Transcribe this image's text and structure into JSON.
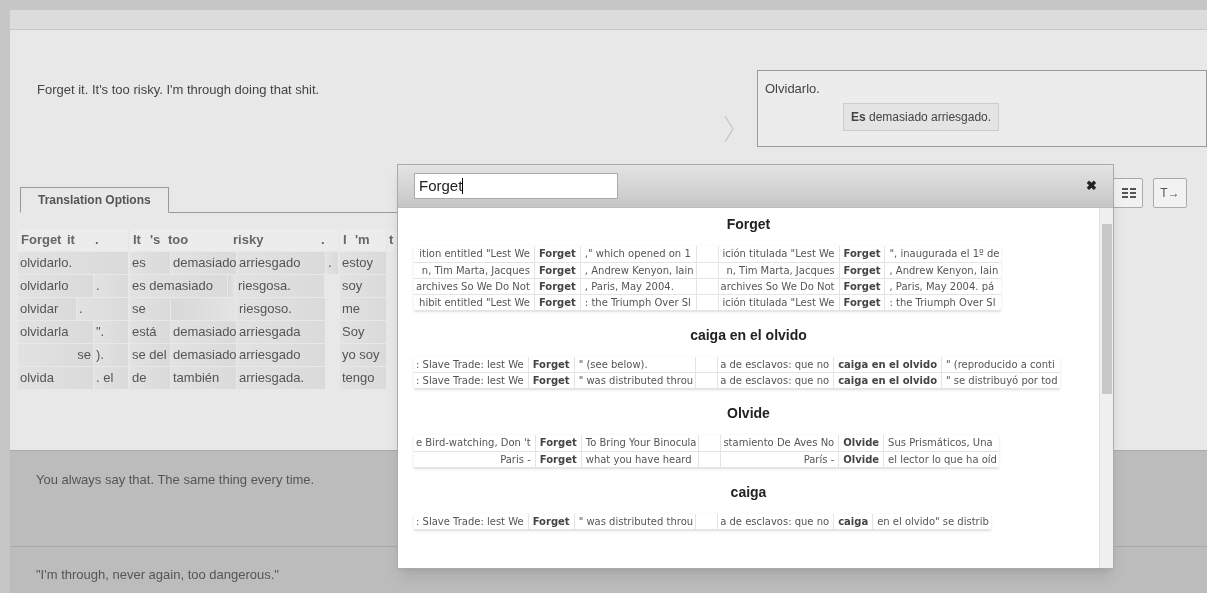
{
  "source_sentence": "Forget it. It's too risky. I'm through doing that shit.",
  "target": {
    "text": "Olvidarlo.",
    "chip": "**Es** demasiado arriesgado."
  },
  "toolbar_buttons": [
    {
      "kind": "icon"
    },
    {
      "kind": "text",
      "label": "T→"
    }
  ],
  "tabs": [
    {
      "label": "Translation Options",
      "selected": true
    }
  ],
  "options": [
    {
      "tokens": [
        "Forget",
        "it",
        "."
      ],
      "rows": [
        [
          "olvidarlo."
        ],
        [
          "olvidarlo",
          "."
        ],
        [
          "olvidar",
          "."
        ],
        [
          "olvidarla",
          "\"."
        ],
        [
          "se",
          ")."
        ],
        [
          "olvida",
          ". el"
        ]
      ]
    },
    {
      "tokens": [
        "It",
        "'s",
        "too",
        "risky",
        "."
      ],
      "rows": [
        [
          "es",
          "demasiado",
          "arriesgado",
          "."
        ],
        [
          "es demasiado",
          "",
          "riesgosa."
        ],
        [
          "se",
          "",
          "riesgoso."
        ],
        [
          "está",
          "demasiado",
          "arriesgada"
        ],
        [
          "se del",
          "demasiado",
          "arriesgado"
        ],
        [
          "de",
          "también",
          "arriesgada."
        ]
      ]
    },
    {
      "tokens": [
        "I",
        "'m"
      ],
      "rows": [
        [
          "estoy"
        ],
        [
          "soy"
        ],
        [
          "me"
        ],
        [
          "Soy"
        ],
        [
          "yo soy"
        ],
        [
          "tengo"
        ]
      ]
    },
    {
      "tokens": [
        "t"
      ]
    }
  ],
  "popup": {
    "search_value": "Forget",
    "close_label": "✖",
    "sections": [
      {
        "heading": "Forget",
        "rows": [
          {
            "source": [
              "ition entitled \"Lest We",
              "Forget",
              ",\" which opened on 1"
            ],
            "target": [
              "ición titulada \"Lest We",
              "Forget",
              "\", inaugurada el 1º de"
            ]
          },
          {
            "source": [
              "n, Tim Marta, Jacques",
              "Forget",
              ", Andrew Kenyon, Iain"
            ],
            "target": [
              "n, Tim Marta, Jacques",
              "Forget",
              ", Andrew Kenyon, Iain"
            ]
          },
          {
            "source": [
              "archives So We Do Not",
              "Forget",
              ", Paris, May 2004."
            ],
            "target": [
              "archives So We Do Not",
              "Forget",
              ", Paris, May 2004. pá"
            ]
          },
          {
            "source": [
              "hibit entitled \"Lest We",
              "Forget",
              ": the Triumph Over Sl"
            ],
            "target": [
              "ición titulada \"Lest We",
              "Forget",
              ": the Triumph Over Sl"
            ]
          }
        ]
      },
      {
        "heading": "caiga en el olvido",
        "rows": [
          {
            "source": [
              ": Slave Trade: lest We",
              "Forget",
              "\" (see below)."
            ],
            "target": [
              "a de esclavos: que no",
              "caiga en el olvido",
              "\" (reproducido a conti"
            ]
          },
          {
            "source": [
              ": Slave Trade: lest We",
              "Forget",
              "\" was distributed throu"
            ],
            "target": [
              "a de esclavos: que no",
              "caiga en el olvido",
              "\" se distribuyó por tod"
            ]
          }
        ]
      },
      {
        "heading": "Olvide",
        "rows": [
          {
            "source": [
              "e Bird-watching, Don 't",
              "Forget",
              "To Bring Your Binocula"
            ],
            "target": [
              "stamiento De Aves No",
              "Olvide",
              "Sus Prismáticos, Una"
            ]
          },
          {
            "source": [
              "Paris -",
              "Forget",
              "what you have heard"
            ],
            "target": [
              "París -",
              "Olvide",
              "el lector lo que ha oíd"
            ]
          }
        ]
      },
      {
        "heading": "caiga",
        "rows": [
          {
            "source": [
              ": Slave Trade: lest We",
              "Forget",
              "\" was distributed throu"
            ],
            "target": [
              "a de esclavos: que no",
              "caiga",
              "en el olvido\" se distrib"
            ]
          }
        ]
      }
    ]
  },
  "sentences": [
    "You always say that. The same thing every time.",
    "\"I'm through, never again, too dangerous.\""
  ]
}
